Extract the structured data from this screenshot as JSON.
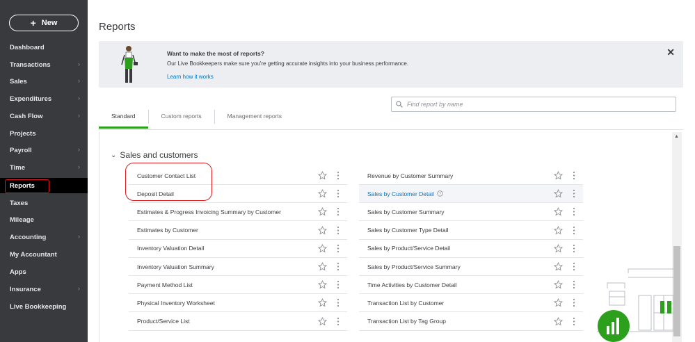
{
  "sidebar": {
    "new_label": "New",
    "items": [
      {
        "label": "Dashboard",
        "chevron": false
      },
      {
        "label": "Transactions",
        "chevron": true
      },
      {
        "label": "Sales",
        "chevron": true
      },
      {
        "label": "Expenditures",
        "chevron": true
      },
      {
        "label": "Cash Flow",
        "chevron": true
      },
      {
        "label": "Projects",
        "chevron": false
      },
      {
        "label": "Payroll",
        "chevron": true
      },
      {
        "label": "Time",
        "chevron": true
      },
      {
        "label": "Reports",
        "chevron": false,
        "active": true
      },
      {
        "label": "Taxes",
        "chevron": false
      },
      {
        "label": "Mileage",
        "chevron": false
      },
      {
        "label": "Accounting",
        "chevron": true
      },
      {
        "label": "My Accountant",
        "chevron": false
      },
      {
        "label": "Apps",
        "chevron": false
      },
      {
        "label": "Insurance",
        "chevron": true
      },
      {
        "label": "Live Bookkeeping",
        "chevron": false
      }
    ]
  },
  "page": {
    "title": "Reports"
  },
  "banner": {
    "title": "Want to make the most of reports?",
    "text": "Our Live Bookkeepers make sure you're getting accurate insights into your business performance.",
    "link": "Learn how it works",
    "close_icon": "close-icon"
  },
  "search": {
    "placeholder": "Find report by name"
  },
  "tabs": [
    {
      "label": "Standard",
      "active": true
    },
    {
      "label": "Custom reports"
    },
    {
      "label": "Management reports"
    }
  ],
  "section": {
    "title": "Sales and customers"
  },
  "reports_left": [
    "Customer Contact List",
    "Deposit Detail",
    "Estimates & Progress Invoicing Summary by Customer",
    "Estimates by Customer",
    "Inventory Valuation Detail",
    "Inventory Valuation Summary",
    "Payment Method List",
    "Physical Inventory Worksheet",
    "Product/Service List"
  ],
  "reports_right": [
    {
      "name": "Revenue by Customer Summary"
    },
    {
      "name": "Sales by Customer Detail",
      "link": true,
      "highlight": true
    },
    {
      "name": "Sales by Customer Summary"
    },
    {
      "name": "Sales by Customer Type Detail"
    },
    {
      "name": "Sales by Product/Service Detail"
    },
    {
      "name": "Sales by Product/Service Summary"
    },
    {
      "name": "Time Activities by Customer Detail"
    },
    {
      "name": "Transaction List by Customer"
    },
    {
      "name": "Transaction List by Tag Group"
    }
  ],
  "colors": {
    "accent": "#2ca01c",
    "link": "#0077c5",
    "sidebar": "#393a3d",
    "highlight_outline": "#e01a1a"
  }
}
